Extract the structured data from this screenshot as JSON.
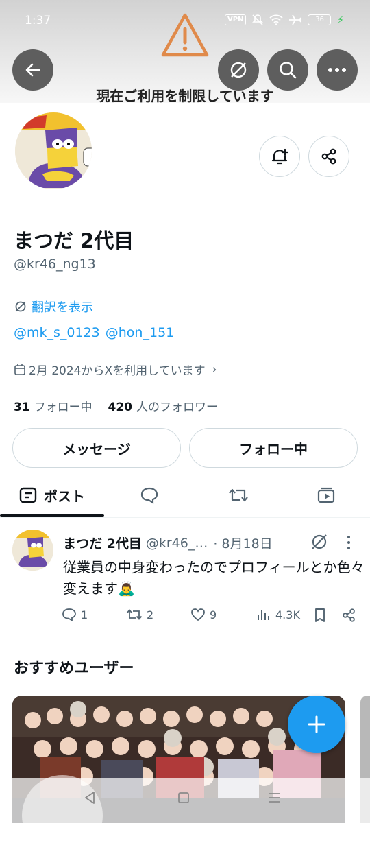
{
  "status_bar": {
    "time": "1:37",
    "vpn": "VPN",
    "battery": "36"
  },
  "header": {
    "restriction_text": "現在ご利用を制限しています",
    "icons": [
      "back-arrow-icon",
      "translate-icon",
      "search-icon",
      "more-icon"
    ]
  },
  "profile": {
    "display_name": "まつだ 2代目",
    "handle": "@kr46_ng13",
    "translate_label": "翻訳を表示",
    "mentions": [
      "@mk_s_0123",
      "@hon_151"
    ],
    "joined": "2月 2024からXを利用しています",
    "following_count": "31",
    "following_label": "フォロー中",
    "followers_count": "420",
    "followers_label": "人のフォロワー",
    "message_button": "メッセージ",
    "follow_button": "フォロー中"
  },
  "tabs": {
    "posts_label": "ポスト"
  },
  "post": {
    "name": "まつだ 2代目",
    "handle": "@kr46_…",
    "date": "· 8月18日",
    "text": "従業員の中身変わったのでプロフィールとか色々変えます🙇‍♂️",
    "replies": "1",
    "reposts": "2",
    "likes": "9",
    "views": "4.3K"
  },
  "recommend": {
    "title": "おすすめユーザー"
  },
  "colors": {
    "accent": "#1d9bf0",
    "warning": "#e08a4a",
    "text": "#0f1419",
    "muted": "#536471"
  }
}
